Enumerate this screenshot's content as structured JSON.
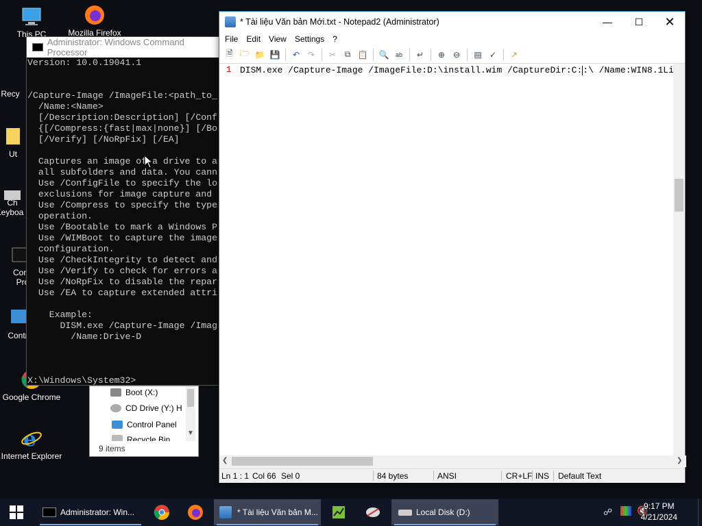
{
  "desktop_icons": [
    {
      "label": "This PC",
      "icon": "computer-icon"
    },
    {
      "label": "Mozilla Firefox",
      "icon": "firefox-icon"
    },
    {
      "label": "Recy",
      "icon": "recycle-bin-icon"
    },
    {
      "label": "Ut",
      "icon": "utility-icon"
    },
    {
      "label": "Ch",
      "icon": "keyboard-icon"
    },
    {
      "label": "Keyboa",
      "icon": "keyboard-label"
    },
    {
      "label": "Con",
      "icon": "cmd-icon"
    },
    {
      "label": "Pro",
      "icon": "cmd-label"
    },
    {
      "label": "Contr",
      "icon": "control-panel-icon"
    },
    {
      "label": "Google Chrome",
      "icon": "chrome-icon"
    },
    {
      "label": "Internet Explorer",
      "icon": "ie-icon"
    }
  ],
  "cmd": {
    "title": "Administrator: Windows Command Processor",
    "lines": [
      "Version: 10.0.19041.1",
      "",
      "",
      "/Capture-Image /ImageFile:<path_to_",
      "  /Name:<Name>",
      "  [/Description:Description] [/Conf",
      "  {[/Compress:{fast|max|none}] [/Bo",
      "  [/Verify] [/NoRpFix] [/EA]",
      "",
      "  Captures an image of a drive to a",
      "  all subfolders and data. You cann",
      "  Use /ConfigFile to specify the lo",
      "  exclusions for image capture and ",
      "  Use /Compress to specify the type",
      "  operation.",
      "  Use /Bootable to mark a Windows P",
      "  Use /WIMBoot to capture the image",
      "  configuration.",
      "  Use /CheckIntegrity to detect and",
      "  Use /Verify to check for errors a",
      "  Use /NoRpFix to disable the repar",
      "  Use /EA to capture extended attri",
      "",
      "    Example:",
      "      DISM.exe /Capture-Image /Imag",
      "        /Name:Drive-D",
      "",
      "",
      "",
      "X:\\Windows\\System32>"
    ]
  },
  "explorer": {
    "items": [
      "Boot (X:)",
      "CD Drive (Y:) H",
      "Control Panel",
      "Recycle Bin"
    ],
    "count": "9 items"
  },
  "notepad": {
    "title": "* Tài liệu Văn bản Mới.txt - Notepad2 (Administrator)",
    "menu": [
      "File",
      "Edit",
      "View",
      "Settings",
      "?"
    ],
    "line_number": "1",
    "text_before_caret": "DISM.exe /Capture-Image /ImageFile:D:\\install.wim /CaptureDir:C:",
    "text_after_caret": ":\\ /Name:WIN8.1Li",
    "status": {
      "ln": "Ln 1 : 1",
      "col": "Col 66",
      "sel": "Sel 0",
      "size": "84 bytes",
      "encoding": "ANSI",
      "eol": "CR+LF",
      "ins": "INS",
      "scheme": "Default Text"
    }
  },
  "taskbar": {
    "cmd_label": "Administrator: Win...",
    "notepad_label": "* Tài liệu Văn bản M...",
    "disk_label": "Local Disk (D:)",
    "time": "9:17 PM",
    "date": "4/21/2024"
  }
}
